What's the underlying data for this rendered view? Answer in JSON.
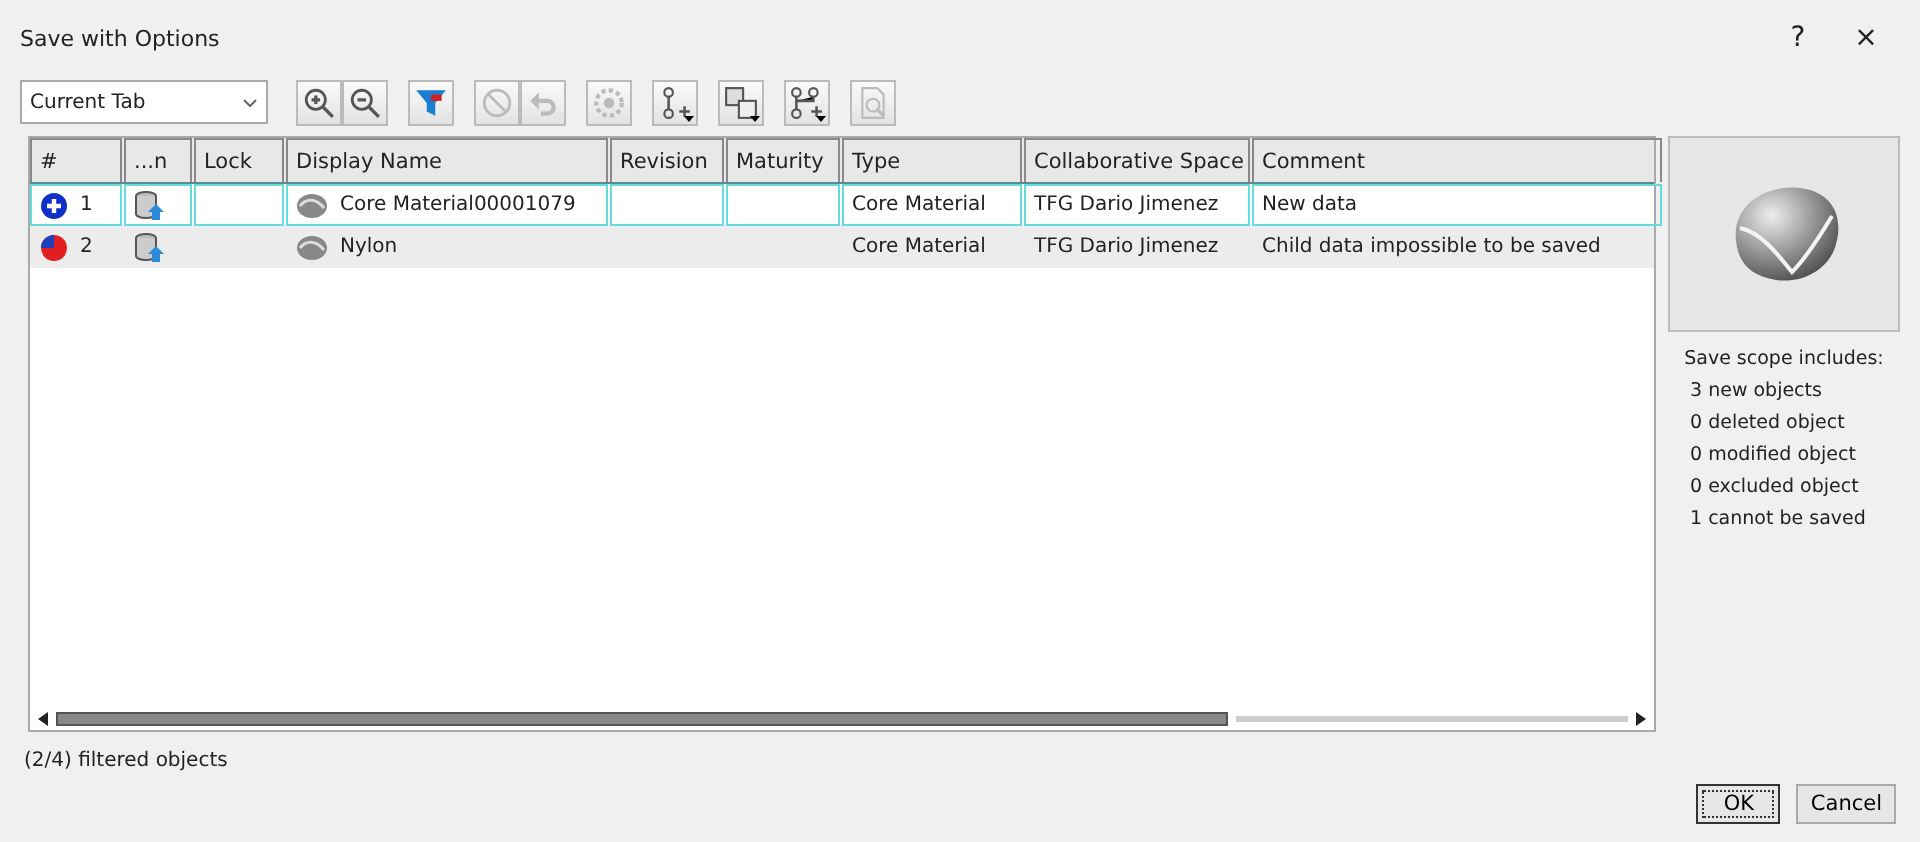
{
  "window": {
    "title": "Save with Options",
    "help": "?",
    "close": "×"
  },
  "scope_select": {
    "value": "Current Tab"
  },
  "toolbar": [
    {
      "kind": "zoom-in",
      "disabled": false,
      "dropdown": false
    },
    {
      "kind": "zoom-out",
      "disabled": false,
      "dropdown": false
    },
    {
      "kind": "filter",
      "disabled": false,
      "dropdown": false
    },
    {
      "kind": "block",
      "disabled": true,
      "dropdown": false
    },
    {
      "kind": "undo",
      "disabled": true,
      "dropdown": false
    },
    {
      "kind": "gear",
      "disabled": true,
      "dropdown": false
    },
    {
      "kind": "branch",
      "disabled": false,
      "dropdown": true
    },
    {
      "kind": "copy",
      "disabled": false,
      "dropdown": true
    },
    {
      "kind": "tree",
      "disabled": false,
      "dropdown": true
    },
    {
      "kind": "preview",
      "disabled": true,
      "dropdown": false
    }
  ],
  "table": {
    "columns": [
      "#",
      "...n",
      "Lock",
      "Display Name",
      "Revision",
      "Maturity",
      "Type",
      "Collaborative Space",
      "Comment"
    ],
    "rows": [
      {
        "selected": true,
        "kind": "new",
        "number": "1",
        "name": "Core Material00001079",
        "type": "Core Material",
        "space": "TFG Dario Jimenez",
        "comment": "New data"
      },
      {
        "selected": false,
        "kind": "error",
        "number": "2",
        "name": "Nylon",
        "type": "Core Material",
        "space": "TFG Dario Jimenez",
        "comment": "Child data impossible to be saved"
      }
    ]
  },
  "summary": {
    "heading": "Save scope includes:",
    "items": [
      {
        "count": "3",
        "label": "new objects"
      },
      {
        "count": "0",
        "label": "deleted object"
      },
      {
        "count": "0",
        "label": "modified object"
      },
      {
        "count": "0",
        "label": "excluded object"
      },
      {
        "count": "1",
        "label": "cannot be saved"
      }
    ]
  },
  "status": {
    "count": "(2/4)",
    "label": "filtered objects"
  },
  "buttons": [
    "OK",
    "Cancel"
  ]
}
